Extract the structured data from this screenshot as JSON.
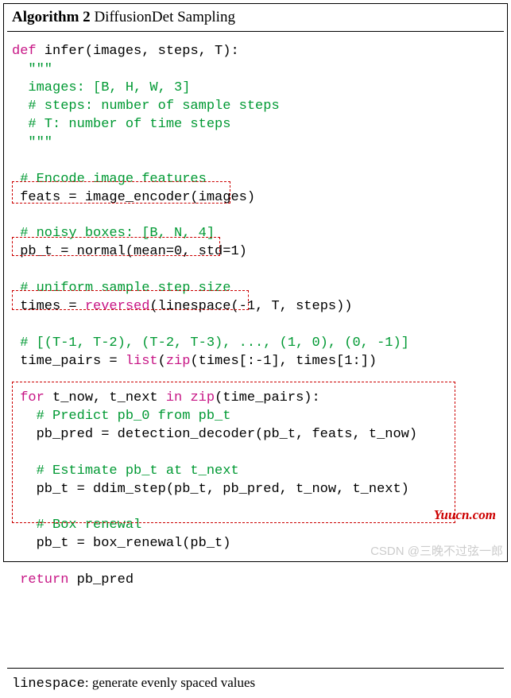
{
  "header": {
    "number": "Algorithm 2",
    "title": " DiffusionDet Sampling"
  },
  "code": {
    "def": "def",
    "sig": " infer(images, steps, T):",
    "doc_open": "  \"\"\"",
    "doc_l1": "  images: [B, H, W, 3]",
    "doc_l2": "  # steps: number of sample steps",
    "doc_l3": "  # T: number of time steps",
    "doc_close": "  \"\"\"",
    "c_encode": " # Encode image features",
    "l_feats": " feats = image_encoder(images)",
    "c_noisy": " # noisy boxes: [B, N, 4]",
    "l_pbt": " pb_t = normal(mean=0, std=1)",
    "c_uniform": " # uniform sample step size",
    "l_times_pre": " times = ",
    "kw_reversed": "reversed",
    "l_times_post": "(linespace(-1, T, steps))",
    "c_pairs": " # [(T-1, T-2), (T-2, T-3), ..., (1, 0), (0, -1)]",
    "l_pairs_pre": " time_pairs = ",
    "kw_list": "list",
    "l_pairs_mid": "(",
    "kw_zip": "zip",
    "l_pairs_post": "(times[:-1], times[1:])",
    "kw_for": " for",
    "l_for_mid": " t_now, t_next ",
    "kw_in": "in",
    "l_for_post1": " ",
    "kw_zip2": "zip",
    "l_for_post2": "(time_pairs):",
    "c_predict": "   # Predict pb_0 from pb_t",
    "l_pred": "   pb_pred = detection_decoder(pb_t, feats, t_now)",
    "c_estimate": "   # Estimate pb_t at t_next",
    "l_ddim": "   pb_t = ddim_step(pb_t, pb_pred, t_now, t_next)",
    "c_renewal": "   # Box renewal",
    "l_renewal": "   pb_t = box_renewal(pb_t)",
    "kw_return": " return",
    "l_return": " pb_pred"
  },
  "footnote": {
    "term": "linespace",
    "sep": ": ",
    "desc": "generate evenly spaced values"
  },
  "watermark": {
    "yuucn": "Yuucn.com",
    "csdn": "CSDN @三晚不过弦一郎"
  }
}
